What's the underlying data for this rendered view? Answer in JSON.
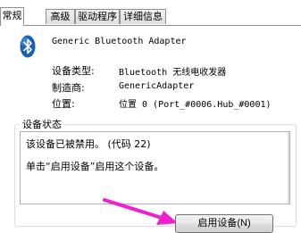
{
  "tabs": [
    {
      "label": "常规",
      "active": true
    },
    {
      "label": "高级",
      "active": false
    },
    {
      "label": "驱动程序",
      "active": false
    },
    {
      "label": "详细信息",
      "active": false
    }
  ],
  "device": {
    "icon": "bluetooth-icon",
    "name": "Generic Bluetooth Adapter"
  },
  "properties": {
    "type_label": "设备类型:",
    "type_value": "Bluetooth 无线电收发器",
    "manufacturer_label": "制造商:",
    "manufacturer_value": "GenericAdapter",
    "location_label": "位置:",
    "location_value": "位置 0 (Port_#0006.Hub_#0001)"
  },
  "status": {
    "group_title": "设备状态",
    "line1": "该设备已被禁用。 (代码 22)",
    "line2": "单击“启用设备”启用这个设备。"
  },
  "buttons": {
    "enable_label": "启用设备(N)"
  },
  "colors": {
    "arrow": "#f020d0",
    "bluetooth_icon": "#1a5fb4"
  }
}
